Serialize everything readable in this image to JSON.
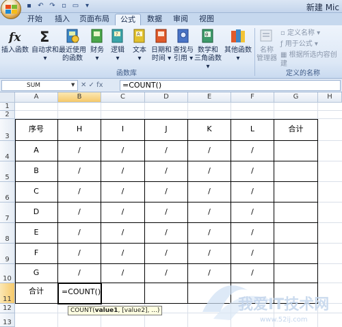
{
  "title": "新建 Mic",
  "tabs": [
    "开始",
    "插入",
    "页面布局",
    "公式",
    "数据",
    "审阅",
    "视图"
  ],
  "active_tab": "公式",
  "ribbon": {
    "insert_function": "插入函数",
    "autosum": "自动求和",
    "recent_1": "最近使用",
    "recent_2": "的函数",
    "financial": "财务",
    "logical": "逻辑",
    "text": "文本",
    "datetime_1": "日期和",
    "datetime_2": "时间",
    "lookup_1": "查找与",
    "lookup_2": "引用",
    "math_1": "数学和",
    "math_2": "三角函数",
    "more": "其他函数",
    "group_library": "函数库",
    "name_manager_1": "名称",
    "name_manager_2": "管理器",
    "define_name": "定义名称",
    "use_in_formula": "用于公式",
    "create_from_selection": "根据所选内容创建",
    "group_names": "定义的名称"
  },
  "formula_bar": {
    "name_box": "SUM",
    "icons": "✕ ✓ fx",
    "formula": "=COUNT()"
  },
  "columns": [
    "A",
    "B",
    "C",
    "D",
    "E",
    "F",
    "G",
    "H"
  ],
  "rows": [
    "1",
    "2",
    "3",
    "4",
    "5",
    "6",
    "7",
    "8",
    "9",
    "10",
    "11",
    "12",
    "13"
  ],
  "table": {
    "header": [
      "序号",
      "H",
      "I",
      "J",
      "K",
      "L",
      "合计"
    ],
    "body": [
      [
        "A",
        "/",
        "/",
        "/",
        "/",
        "/",
        ""
      ],
      [
        "B",
        "/",
        "/",
        "/",
        "/",
        "/",
        ""
      ],
      [
        "C",
        "/",
        "/",
        "/",
        "/",
        "/",
        ""
      ],
      [
        "D",
        "/",
        "/",
        "/",
        "/",
        "/",
        ""
      ],
      [
        "E",
        "/",
        "/",
        "/",
        "/",
        "/",
        ""
      ],
      [
        "F",
        "/",
        "/",
        "/",
        "/",
        "/",
        ""
      ],
      [
        "G",
        "/",
        "/",
        "/",
        "/",
        "/",
        ""
      ]
    ],
    "total_label": "合计",
    "edit_value": "=COUNT()"
  },
  "tooltip": {
    "fn": "COUNT(",
    "arg1": "value1",
    "rest": ", [value2], ...)"
  },
  "watermark": {
    "text": "我爱IT技术网",
    "url": "www.52ij.com"
  },
  "colors": {
    "ribbon_bg": "#dde8f6",
    "selected_header": "#f6c96a",
    "tooltip_bg": "#ffffe1"
  }
}
